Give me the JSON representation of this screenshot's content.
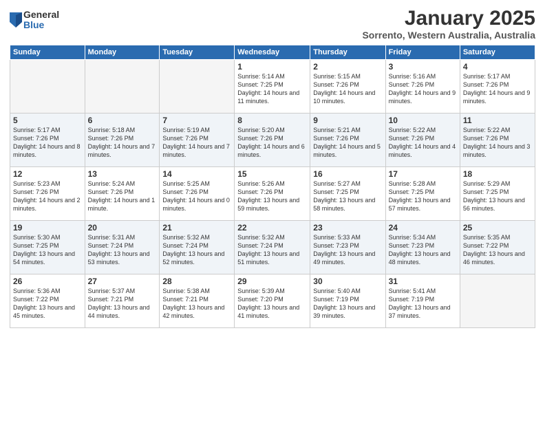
{
  "logo": {
    "general": "General",
    "blue": "Blue"
  },
  "header": {
    "month": "January 2025",
    "location": "Sorrento, Western Australia, Australia"
  },
  "weekdays": [
    "Sunday",
    "Monday",
    "Tuesday",
    "Wednesday",
    "Thursday",
    "Friday",
    "Saturday"
  ],
  "weeks": [
    {
      "shaded": false,
      "days": [
        {
          "num": "",
          "info": ""
        },
        {
          "num": "",
          "info": ""
        },
        {
          "num": "",
          "info": ""
        },
        {
          "num": "1",
          "info": "Sunrise: 5:14 AM\nSunset: 7:25 PM\nDaylight: 14 hours\nand 11 minutes."
        },
        {
          "num": "2",
          "info": "Sunrise: 5:15 AM\nSunset: 7:26 PM\nDaylight: 14 hours\nand 10 minutes."
        },
        {
          "num": "3",
          "info": "Sunrise: 5:16 AM\nSunset: 7:26 PM\nDaylight: 14 hours\nand 9 minutes."
        },
        {
          "num": "4",
          "info": "Sunrise: 5:17 AM\nSunset: 7:26 PM\nDaylight: 14 hours\nand 9 minutes."
        }
      ]
    },
    {
      "shaded": true,
      "days": [
        {
          "num": "5",
          "info": "Sunrise: 5:17 AM\nSunset: 7:26 PM\nDaylight: 14 hours\nand 8 minutes."
        },
        {
          "num": "6",
          "info": "Sunrise: 5:18 AM\nSunset: 7:26 PM\nDaylight: 14 hours\nand 7 minutes."
        },
        {
          "num": "7",
          "info": "Sunrise: 5:19 AM\nSunset: 7:26 PM\nDaylight: 14 hours\nand 7 minutes."
        },
        {
          "num": "8",
          "info": "Sunrise: 5:20 AM\nSunset: 7:26 PM\nDaylight: 14 hours\nand 6 minutes."
        },
        {
          "num": "9",
          "info": "Sunrise: 5:21 AM\nSunset: 7:26 PM\nDaylight: 14 hours\nand 5 minutes."
        },
        {
          "num": "10",
          "info": "Sunrise: 5:22 AM\nSunset: 7:26 PM\nDaylight: 14 hours\nand 4 minutes."
        },
        {
          "num": "11",
          "info": "Sunrise: 5:22 AM\nSunset: 7:26 PM\nDaylight: 14 hours\nand 3 minutes."
        }
      ]
    },
    {
      "shaded": false,
      "days": [
        {
          "num": "12",
          "info": "Sunrise: 5:23 AM\nSunset: 7:26 PM\nDaylight: 14 hours\nand 2 minutes."
        },
        {
          "num": "13",
          "info": "Sunrise: 5:24 AM\nSunset: 7:26 PM\nDaylight: 14 hours\nand 1 minute."
        },
        {
          "num": "14",
          "info": "Sunrise: 5:25 AM\nSunset: 7:26 PM\nDaylight: 14 hours\nand 0 minutes."
        },
        {
          "num": "15",
          "info": "Sunrise: 5:26 AM\nSunset: 7:26 PM\nDaylight: 13 hours\nand 59 minutes."
        },
        {
          "num": "16",
          "info": "Sunrise: 5:27 AM\nSunset: 7:25 PM\nDaylight: 13 hours\nand 58 minutes."
        },
        {
          "num": "17",
          "info": "Sunrise: 5:28 AM\nSunset: 7:25 PM\nDaylight: 13 hours\nand 57 minutes."
        },
        {
          "num": "18",
          "info": "Sunrise: 5:29 AM\nSunset: 7:25 PM\nDaylight: 13 hours\nand 56 minutes."
        }
      ]
    },
    {
      "shaded": true,
      "days": [
        {
          "num": "19",
          "info": "Sunrise: 5:30 AM\nSunset: 7:25 PM\nDaylight: 13 hours\nand 54 minutes."
        },
        {
          "num": "20",
          "info": "Sunrise: 5:31 AM\nSunset: 7:24 PM\nDaylight: 13 hours\nand 53 minutes."
        },
        {
          "num": "21",
          "info": "Sunrise: 5:32 AM\nSunset: 7:24 PM\nDaylight: 13 hours\nand 52 minutes."
        },
        {
          "num": "22",
          "info": "Sunrise: 5:32 AM\nSunset: 7:24 PM\nDaylight: 13 hours\nand 51 minutes."
        },
        {
          "num": "23",
          "info": "Sunrise: 5:33 AM\nSunset: 7:23 PM\nDaylight: 13 hours\nand 49 minutes."
        },
        {
          "num": "24",
          "info": "Sunrise: 5:34 AM\nSunset: 7:23 PM\nDaylight: 13 hours\nand 48 minutes."
        },
        {
          "num": "25",
          "info": "Sunrise: 5:35 AM\nSunset: 7:22 PM\nDaylight: 13 hours\nand 46 minutes."
        }
      ]
    },
    {
      "shaded": false,
      "days": [
        {
          "num": "26",
          "info": "Sunrise: 5:36 AM\nSunset: 7:22 PM\nDaylight: 13 hours\nand 45 minutes."
        },
        {
          "num": "27",
          "info": "Sunrise: 5:37 AM\nSunset: 7:21 PM\nDaylight: 13 hours\nand 44 minutes."
        },
        {
          "num": "28",
          "info": "Sunrise: 5:38 AM\nSunset: 7:21 PM\nDaylight: 13 hours\nand 42 minutes."
        },
        {
          "num": "29",
          "info": "Sunrise: 5:39 AM\nSunset: 7:20 PM\nDaylight: 13 hours\nand 41 minutes."
        },
        {
          "num": "30",
          "info": "Sunrise: 5:40 AM\nSunset: 7:19 PM\nDaylight: 13 hours\nand 39 minutes."
        },
        {
          "num": "31",
          "info": "Sunrise: 5:41 AM\nSunset: 7:19 PM\nDaylight: 13 hours\nand 37 minutes."
        },
        {
          "num": "",
          "info": ""
        }
      ]
    }
  ]
}
